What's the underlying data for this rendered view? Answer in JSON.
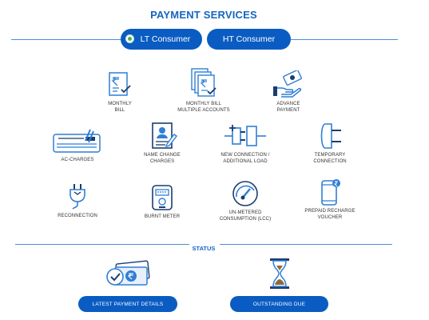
{
  "header": {
    "title": "PAYMENT SERVICES"
  },
  "consumer_tabs": [
    {
      "label": "LT Consumer",
      "selected": true
    },
    {
      "label": "HT Consumer",
      "selected": false
    }
  ],
  "services": [
    {
      "line1": "MONTHLY",
      "line2": "BILL",
      "icon": "bill-icon"
    },
    {
      "line1": "MONTHLY BILL",
      "line2": "MULTIPLE ACCOUNTS",
      "icon": "multiple-bills-icon"
    },
    {
      "line1": "ADVANCE",
      "line2": "PAYMENT",
      "icon": "hand-money-icon"
    },
    {
      "line1": "AC-CHARGES",
      "line2": "",
      "icon": "air-conditioner-icon"
    },
    {
      "line1": "NAME CHANGE",
      "line2": "CHARGES",
      "icon": "name-change-icon"
    },
    {
      "line1": "NEW CONNECTION /",
      "line2": "ADDITIONAL LOAD",
      "icon": "plug-connection-icon"
    },
    {
      "line1": "TEMPORARY",
      "line2": "CONNECTION",
      "icon": "temporary-plug-icon"
    },
    {
      "line1": "RECONNECTION",
      "line2": "",
      "icon": "reconnection-plug-icon"
    },
    {
      "line1": "BURNT METER",
      "line2": "",
      "icon": "meter-icon"
    },
    {
      "line1": "UN-METERED",
      "line2": "CONSUMPTION (LCC)",
      "icon": "gauge-icon"
    },
    {
      "line1": "PREPAID RECHARGE",
      "line2": "VOUCHER",
      "icon": "phone-recharge-icon"
    }
  ],
  "status": {
    "label": "STATUS",
    "latest_payment": "LATEST PAYMENT DETAILS",
    "outstanding_due": "OUTSTANDING DUE"
  },
  "colors": {
    "primary": "#0a5cc2",
    "title": "#1565c0",
    "icon_blue": "#2f7fd6",
    "icon_dark": "#1b3d6e",
    "radio": "#4caf50"
  }
}
